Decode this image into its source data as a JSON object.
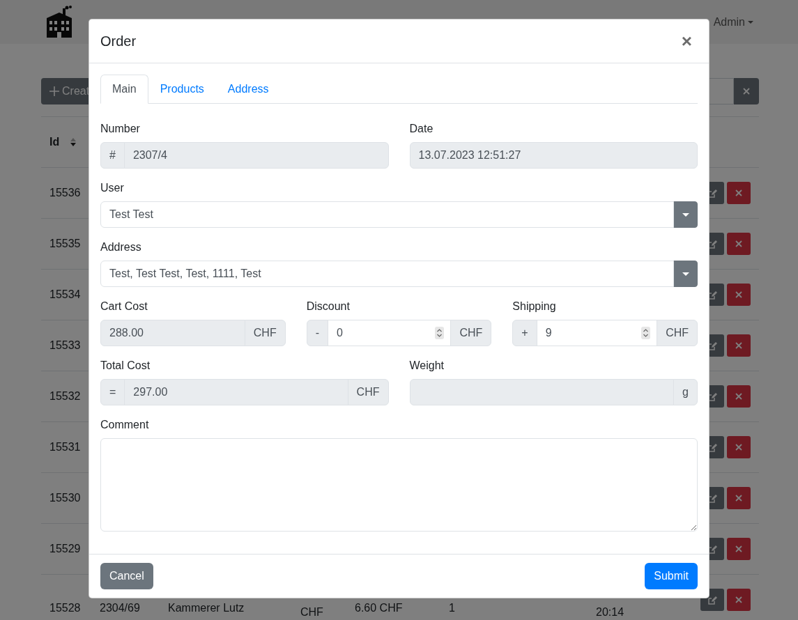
{
  "navbar": {
    "user_menu": "Admin"
  },
  "toolbar": {
    "create_button": "Creat"
  },
  "table": {
    "columns": [
      {
        "label": "Id"
      }
    ],
    "rows": [
      {
        "id": "15536"
      },
      {
        "id": "15535"
      },
      {
        "id": "15534"
      },
      {
        "id": "15533"
      },
      {
        "id": "15532"
      },
      {
        "id": "15531"
      },
      {
        "id": "15530"
      },
      {
        "id": "15529"
      },
      {
        "id": "15528",
        "number": "2304/69",
        "customer": "Kammerer Lutz",
        "column_4": "CHF",
        "column_5": "6.60 CHF",
        "column_6": "1",
        "column_8": "20:14"
      }
    ]
  },
  "modal": {
    "title": "Order",
    "close": "×",
    "tabs": [
      {
        "label": "Main",
        "selected": true
      },
      {
        "label": "Products",
        "selected": false
      },
      {
        "label": "Address",
        "selected": false
      }
    ],
    "rows": [
      [
        {
          "kind": "text",
          "label": "Number",
          "prefix": "#",
          "value": "2307/4",
          "disabled": true
        },
        {
          "kind": "text",
          "label": "Date",
          "value": "13.07.2023 12:51:27",
          "disabled": true
        }
      ],
      [
        {
          "kind": "select",
          "label": "User",
          "value": "Test Test"
        }
      ],
      [
        {
          "kind": "select",
          "label": "Address",
          "value": "Test, Test Test, Test, 1111, Test"
        }
      ],
      [
        {
          "kind": "text",
          "label": "Cart Cost",
          "value": "288.00",
          "suffix": "CHF",
          "disabled": true
        },
        {
          "kind": "number",
          "label": "Discount",
          "prefix": "-",
          "value": "0",
          "suffix": "CHF",
          "disabled": false
        },
        {
          "kind": "number",
          "label": "Shipping",
          "prefix": "+",
          "value": "9",
          "suffix": "CHF",
          "disabled": false
        }
      ],
      [
        {
          "kind": "text",
          "label": "Total Cost",
          "prefix": "=",
          "value": "297.00",
          "suffix": "CHF",
          "disabled": true
        },
        {
          "kind": "text",
          "label": "Weight",
          "suffix": "g",
          "disabled": true
        }
      ],
      [
        {
          "kind": "textarea",
          "label": "Comment"
        }
      ]
    ],
    "buttons": [
      {
        "kind": "secondary",
        "label": "Cancel"
      },
      {
        "kind": "primary",
        "label": "Submit"
      }
    ]
  }
}
